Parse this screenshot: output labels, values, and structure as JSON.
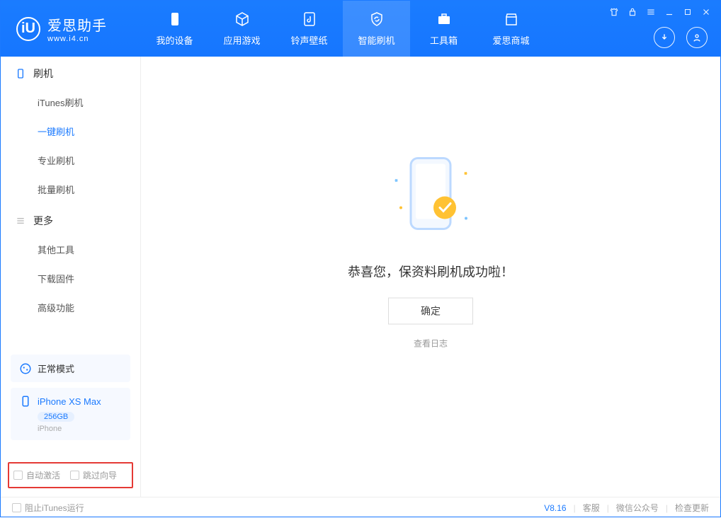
{
  "app": {
    "title": "爱思助手",
    "subtitle": "www.i4.cn"
  },
  "nav": {
    "tabs": [
      {
        "label": "我的设备"
      },
      {
        "label": "应用游戏"
      },
      {
        "label": "铃声壁纸"
      },
      {
        "label": "智能刷机"
      },
      {
        "label": "工具箱"
      },
      {
        "label": "爱思商城"
      }
    ]
  },
  "sidebar": {
    "section1": {
      "title": "刷机",
      "items": [
        "iTunes刷机",
        "一键刷机",
        "专业刷机",
        "批量刷机"
      ]
    },
    "section2": {
      "title": "更多",
      "items": [
        "其他工具",
        "下载固件",
        "高级功能"
      ]
    },
    "mode_panel": {
      "label": "正常模式"
    },
    "device_panel": {
      "name": "iPhone XS Max",
      "storage": "256GB",
      "type": "iPhone"
    },
    "options": {
      "auto_activate": "自动激活",
      "skip_guide": "跳过向导"
    }
  },
  "main": {
    "success_title": "恭喜您，保资料刷机成功啦！",
    "confirm_label": "确定",
    "view_log_label": "查看日志"
  },
  "statusbar": {
    "block_itunes": "阻止iTunes运行",
    "version": "V8.16",
    "service": "客服",
    "wechat": "微信公众号",
    "update": "检查更新"
  }
}
